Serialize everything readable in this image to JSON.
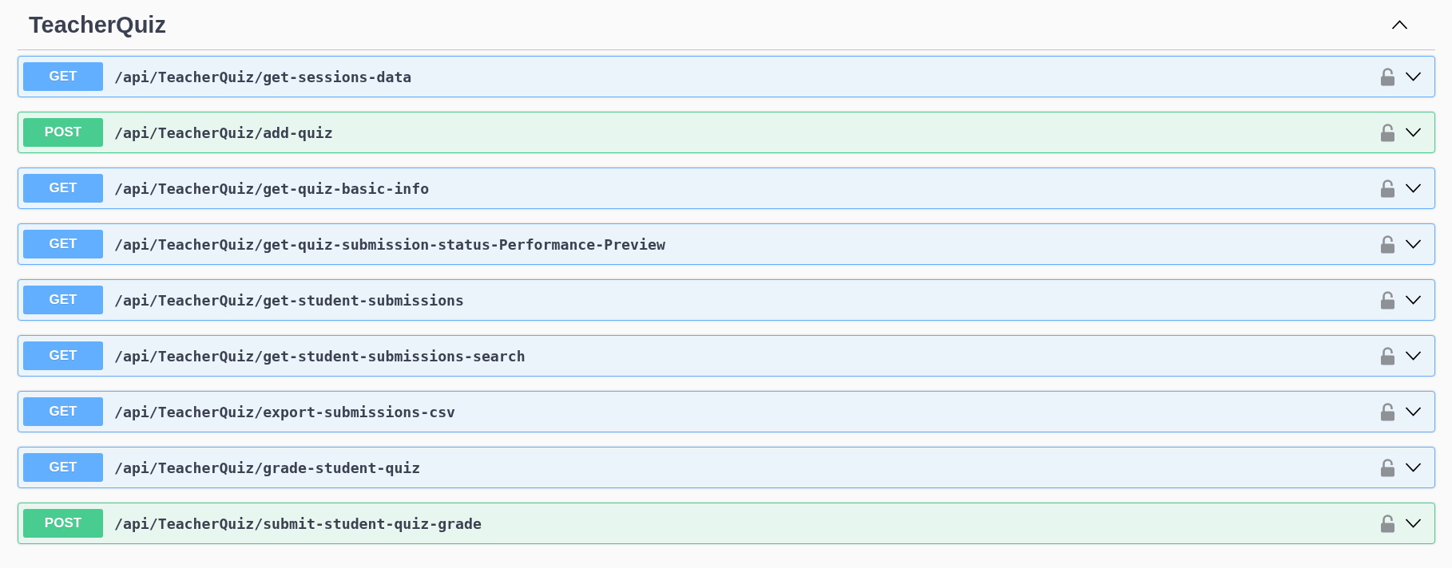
{
  "section": {
    "title": "TeacherQuiz",
    "expanded": true
  },
  "operations": [
    {
      "kind": "get",
      "method": "GET",
      "path": "/api/TeacherQuiz/get-sessions-data",
      "locked": false,
      "expanded": false
    },
    {
      "kind": "post",
      "method": "POST",
      "path": "/api/TeacherQuiz/add-quiz",
      "locked": false,
      "expanded": false
    },
    {
      "kind": "get",
      "method": "GET",
      "path": "/api/TeacherQuiz/get-quiz-basic-info",
      "locked": false,
      "expanded": false
    },
    {
      "kind": "get",
      "method": "GET",
      "path": "/api/TeacherQuiz/get-quiz-submission-status-Performance-Preview",
      "locked": false,
      "expanded": false
    },
    {
      "kind": "get",
      "method": "GET",
      "path": "/api/TeacherQuiz/get-student-submissions",
      "locked": false,
      "expanded": false
    },
    {
      "kind": "get",
      "method": "GET",
      "path": "/api/TeacherQuiz/get-student-submissions-search",
      "locked": false,
      "expanded": false
    },
    {
      "kind": "get",
      "method": "GET",
      "path": "/api/TeacherQuiz/export-submissions-csv",
      "locked": false,
      "expanded": false
    },
    {
      "kind": "get",
      "method": "GET",
      "path": "/api/TeacherQuiz/grade-student-quiz",
      "locked": false,
      "expanded": false
    },
    {
      "kind": "post",
      "method": "POST",
      "path": "/api/TeacherQuiz/submit-student-quiz-grade",
      "locked": false,
      "expanded": false
    }
  ]
}
